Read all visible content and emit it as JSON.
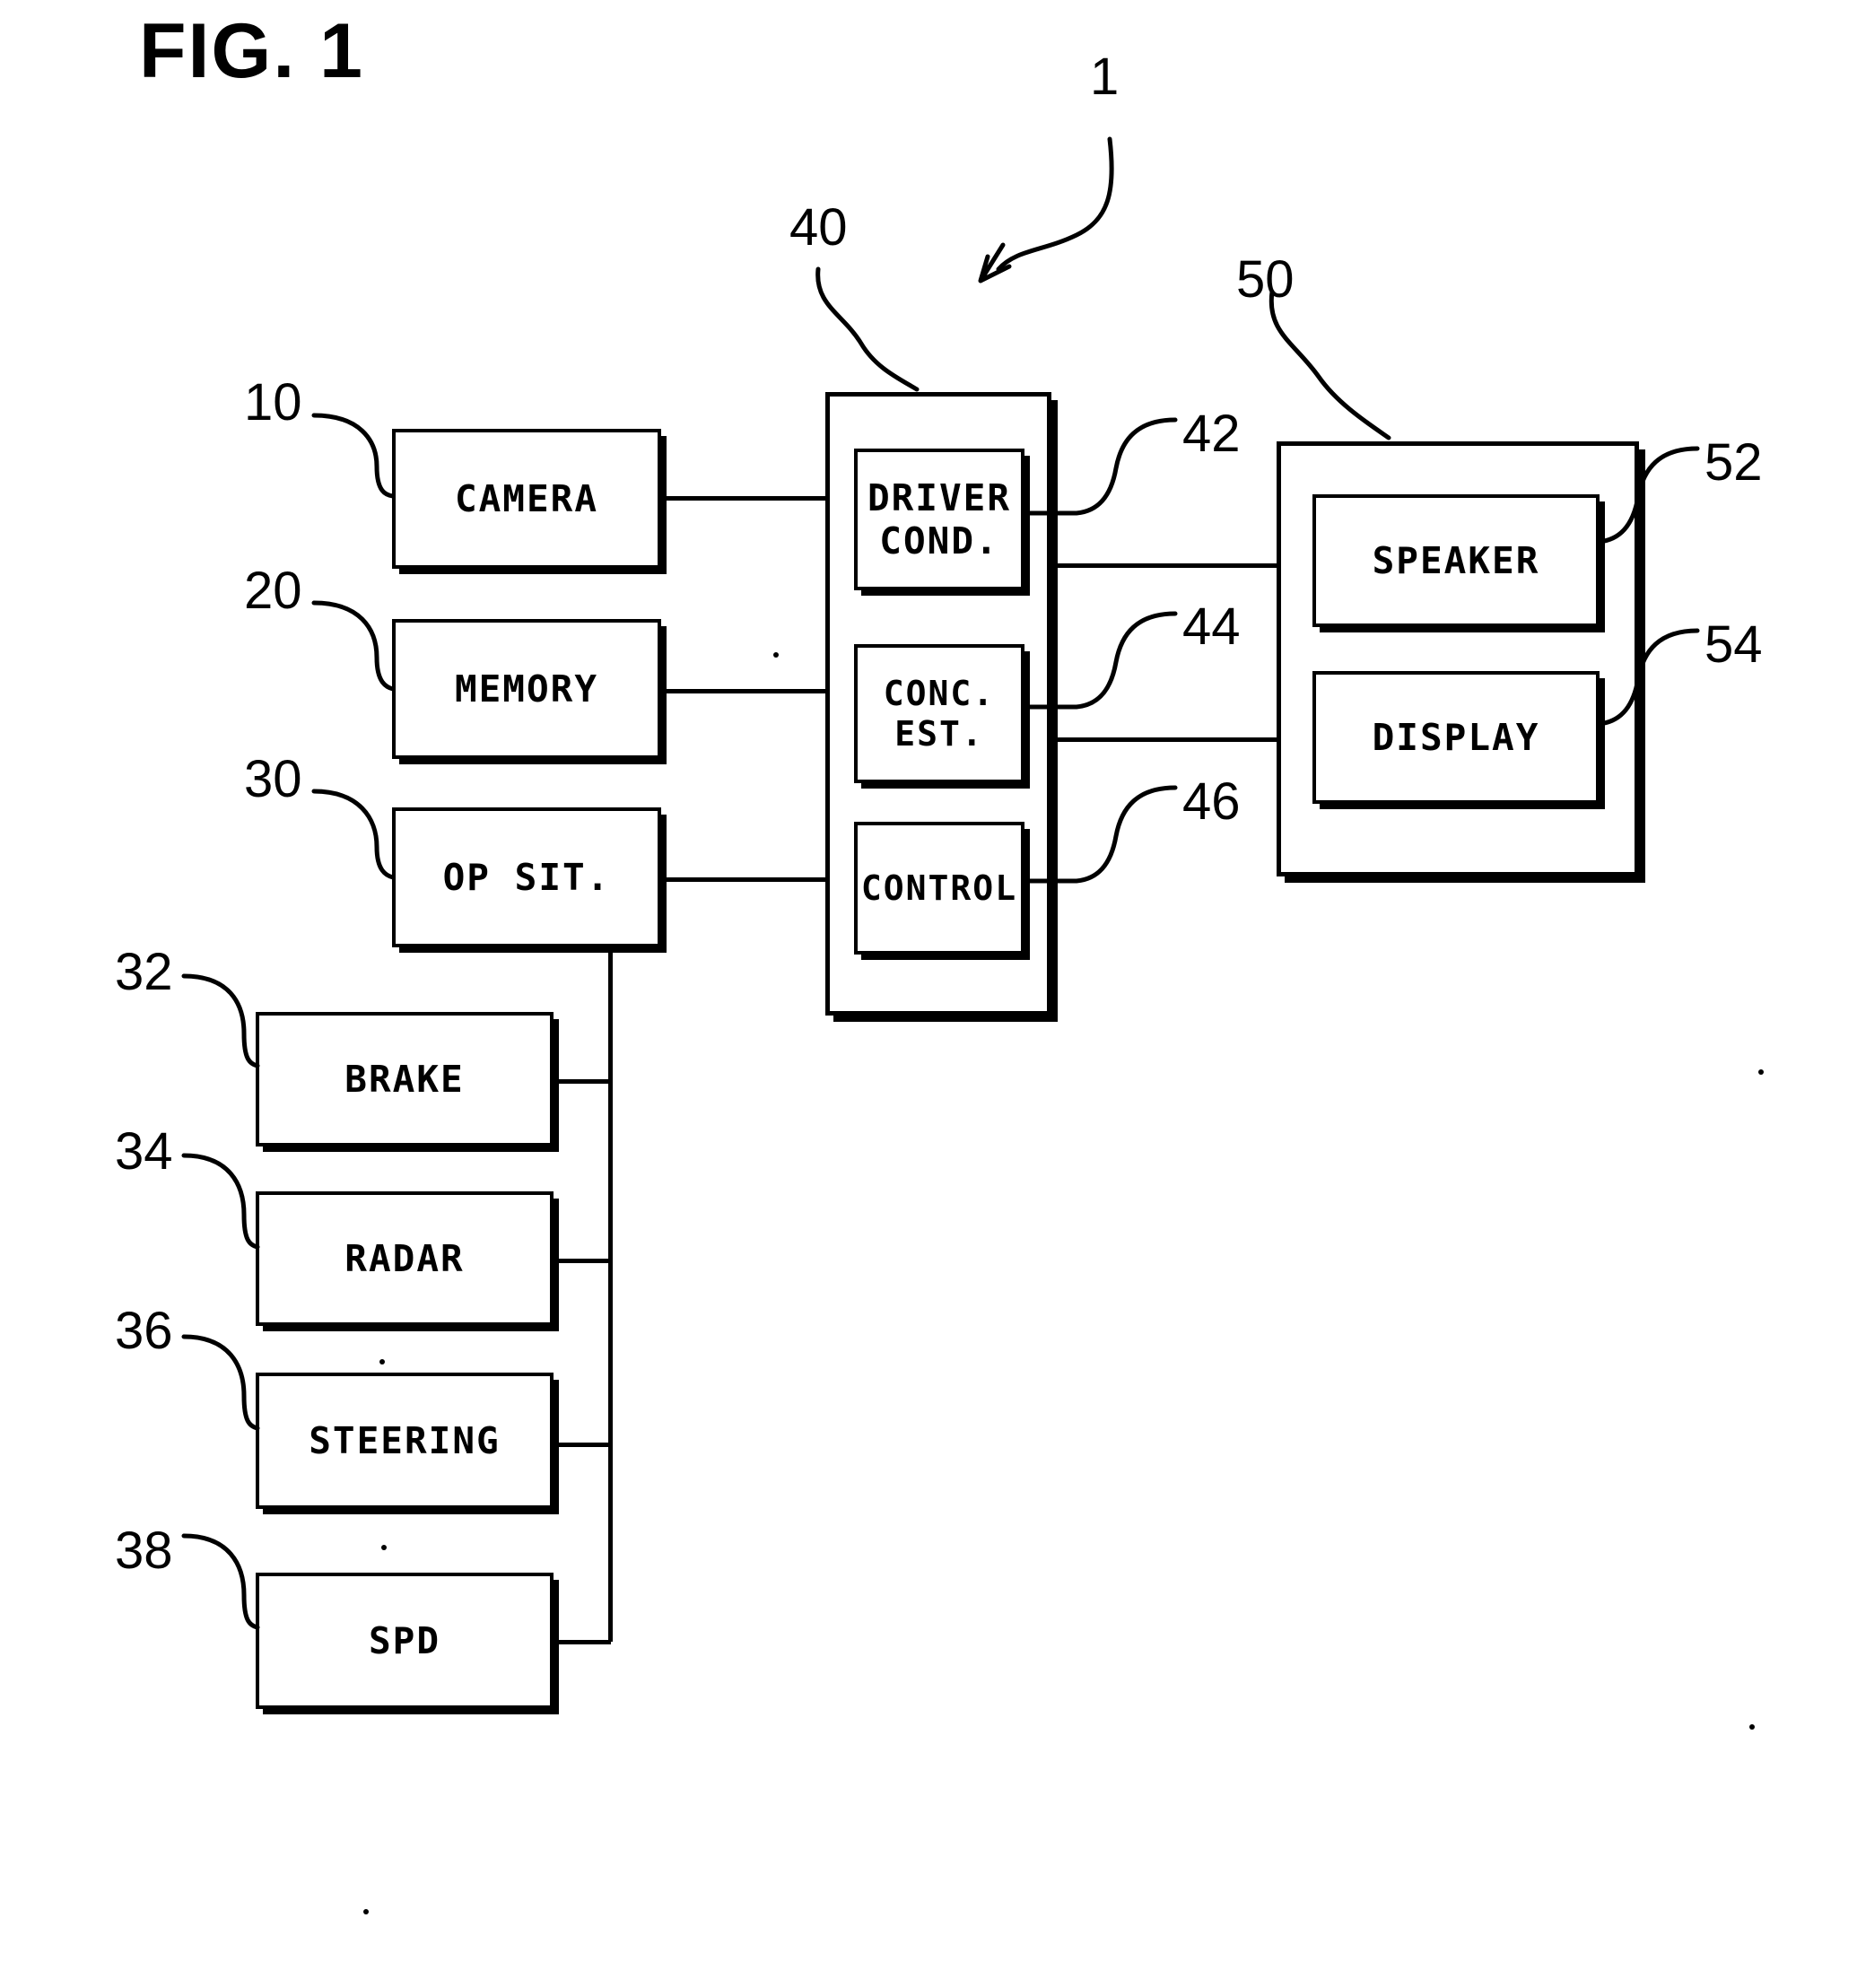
{
  "figure": {
    "title": "FIG. 1",
    "system_ref": "1"
  },
  "inputs": {
    "camera": {
      "label": "CAMERA",
      "ref": "10"
    },
    "memory": {
      "label": "MEMORY",
      "ref": "20"
    },
    "op_sit": {
      "label": "OP SIT.",
      "ref": "30"
    }
  },
  "sensors": [
    {
      "label": "BRAKE",
      "ref": "32"
    },
    {
      "label": "RADAR",
      "ref": "34"
    },
    {
      "label": "STEERING",
      "ref": "36"
    },
    {
      "label": "SPD",
      "ref": "38"
    }
  ],
  "ecu": {
    "ref": "40",
    "modules": [
      {
        "label": "DRIVER\nCOND.",
        "ref": "42"
      },
      {
        "label": "CONC. EST.",
        "ref": "44"
      },
      {
        "label": "CONTROL",
        "ref": "46"
      }
    ]
  },
  "output": {
    "ref": "50",
    "devices": [
      {
        "label": "SPEAKER",
        "ref": "52"
      },
      {
        "label": "DISPLAY",
        "ref": "54"
      }
    ]
  },
  "colors": {
    "ink": "#000000",
    "paper": "#ffffff"
  }
}
